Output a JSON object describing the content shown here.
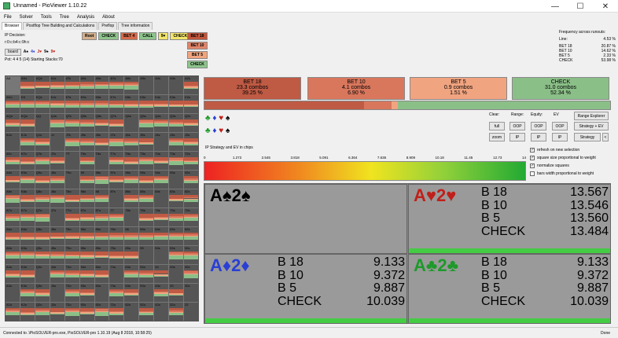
{
  "window": {
    "title": "Unnamed - PioViewer 1.10.22",
    "min": "—",
    "max": "☐",
    "close": "✕"
  },
  "menu": [
    "File",
    "Solver",
    "Tools",
    "Tree",
    "Analysis",
    "About"
  ],
  "tabs": [
    "Browser",
    "Postflop Tree Building and Calculations",
    "Preflop",
    "Tree information"
  ],
  "left": {
    "ip_decision": "IP Decision:",
    "line": "r:0:c:b4:c:9h:c",
    "board_label": "board",
    "board_cards": [
      "A♠",
      "4♦",
      "J♥",
      "9♠",
      "9♥"
    ],
    "pot": "Pot: 4 4 5 (14) Starting Stacks:70"
  },
  "line_buttons": [
    {
      "label": "Root",
      "bg": "#d4b08c"
    },
    {
      "label": "CHECK",
      "bg": "#8dc48c"
    },
    {
      "label": "BET 4",
      "bg": "#d66a4a"
    },
    {
      "label": "CALL",
      "bg": "#8dc48c"
    },
    {
      "label": "9♥",
      "bg": "#f2e56b"
    },
    {
      "label": "CHECK",
      "bg": "#f2e56b"
    }
  ],
  "stack_buttons": [
    {
      "label": "BET 18",
      "bg": "#c0553b"
    },
    {
      "label": "BET 10",
      "bg": "#e0856a"
    },
    {
      "label": "BET 5",
      "bg": "#f0a57e"
    },
    {
      "label": "CHECK",
      "bg": "#8dc48c"
    }
  ],
  "freq": {
    "header": "Frequency across runouts:",
    "line_label": "Line:",
    "line_val": "4.53 %",
    "rows": [
      {
        "k": "BET 18",
        "v": "20.87 %"
      },
      {
        "k": "BET 10",
        "v": "14.62 %"
      },
      {
        "k": "BET 5",
        "v": "2.33 %"
      },
      {
        "k": "CHECK",
        "v": "53.98 %"
      }
    ]
  },
  "actions": [
    {
      "name": "BET 18",
      "combos": "23.3 combos",
      "pct": "39.25 %",
      "bg": "#bf5a44"
    },
    {
      "name": "BET 10",
      "combos": "4.1 combos",
      "pct": "6.90 %",
      "bg": "#d9775d"
    },
    {
      "name": "BET 5",
      "combos": "0.9 combos",
      "pct": "1.51 %",
      "bg": "#f0a480"
    },
    {
      "name": "CHECK",
      "combos": "31.0 combos",
      "pct": "52.34 %",
      "bg": "#8bbf88"
    }
  ],
  "strategy_bar": [
    {
      "frac": 39.25,
      "color": "#bf5a44"
    },
    {
      "frac": 6.9,
      "color": "#d9775d"
    },
    {
      "frac": 1.51,
      "color": "#f0a480"
    },
    {
      "frac": 52.34,
      "color": "#8bbf88"
    }
  ],
  "controls": {
    "clear": "Clear:",
    "range": "Range:",
    "equity": "Equity:",
    "ev": "EV",
    "range_explorer": "Range Explorer",
    "full": "full",
    "zoom": "zoom",
    "oop1": "OOP",
    "ip1": "IP",
    "oop2": "OOP",
    "ip2": "IP",
    "oop3": "OOP",
    "ip3": "IP",
    "strategy_ev": "Strategy + EV",
    "strategy": "Strategy",
    "arrow": "<"
  },
  "ev_label": "IP Strategy and EV in chips",
  "scale": [
    "0",
    "1.273",
    "2.545",
    "3.818",
    "5.091",
    "6.364",
    "7.636",
    "8.909",
    "10.18",
    "11.45",
    "12.73",
    "14"
  ],
  "checks": [
    {
      "label": "refresh on new selection",
      "on": true
    },
    {
      "label": "square size proportional to weight",
      "on": true
    },
    {
      "label": "normalize squares",
      "on": true
    },
    {
      "label": "bars width proportional to weight",
      "on": false
    }
  ],
  "combos": [
    {
      "hand_a": "A♠",
      "hand_b": "2♠",
      "color": "#000",
      "rows": [],
      "bar": false
    },
    {
      "hand_a": "A♥",
      "hand_b": "2♥",
      "color": "#c0201a",
      "rows": [
        {
          "k": "B 18",
          "v": "13.567"
        },
        {
          "k": "B 10",
          "v": "13.546"
        },
        {
          "k": "B 5",
          "v": "13.560"
        },
        {
          "k": "CHECK",
          "v": "13.484"
        }
      ],
      "bar": true
    },
    {
      "hand_a": "A♦",
      "hand_b": "2♦",
      "color": "#2a3fd4",
      "rows": [
        {
          "k": "B 18",
          "v": "9.133"
        },
        {
          "k": "B 10",
          "v": "9.372"
        },
        {
          "k": "B 5",
          "v": "9.887"
        },
        {
          "k": "CHECK",
          "v": "10.039"
        }
      ],
      "bar": true
    },
    {
      "hand_a": "A♣",
      "hand_b": "2♣",
      "color": "#1d9a2a",
      "rows": [
        {
          "k": "B 18",
          "v": "9.133"
        },
        {
          "k": "B 10",
          "v": "9.372"
        },
        {
          "k": "B 5",
          "v": "9.887"
        },
        {
          "k": "CHECK",
          "v": "10.039"
        }
      ],
      "bar": true
    }
  ],
  "status": {
    "text": "Connected to .\\PioSOLVER-pro.exe, PioSOLVER-pro 1.10.19 (Aug 8 2018, 10:58:25)",
    "done": "Done"
  },
  "ranks": [
    "A",
    "K",
    "Q",
    "J",
    "T",
    "9",
    "8",
    "7",
    "6",
    "5",
    "4",
    "3",
    "2"
  ]
}
